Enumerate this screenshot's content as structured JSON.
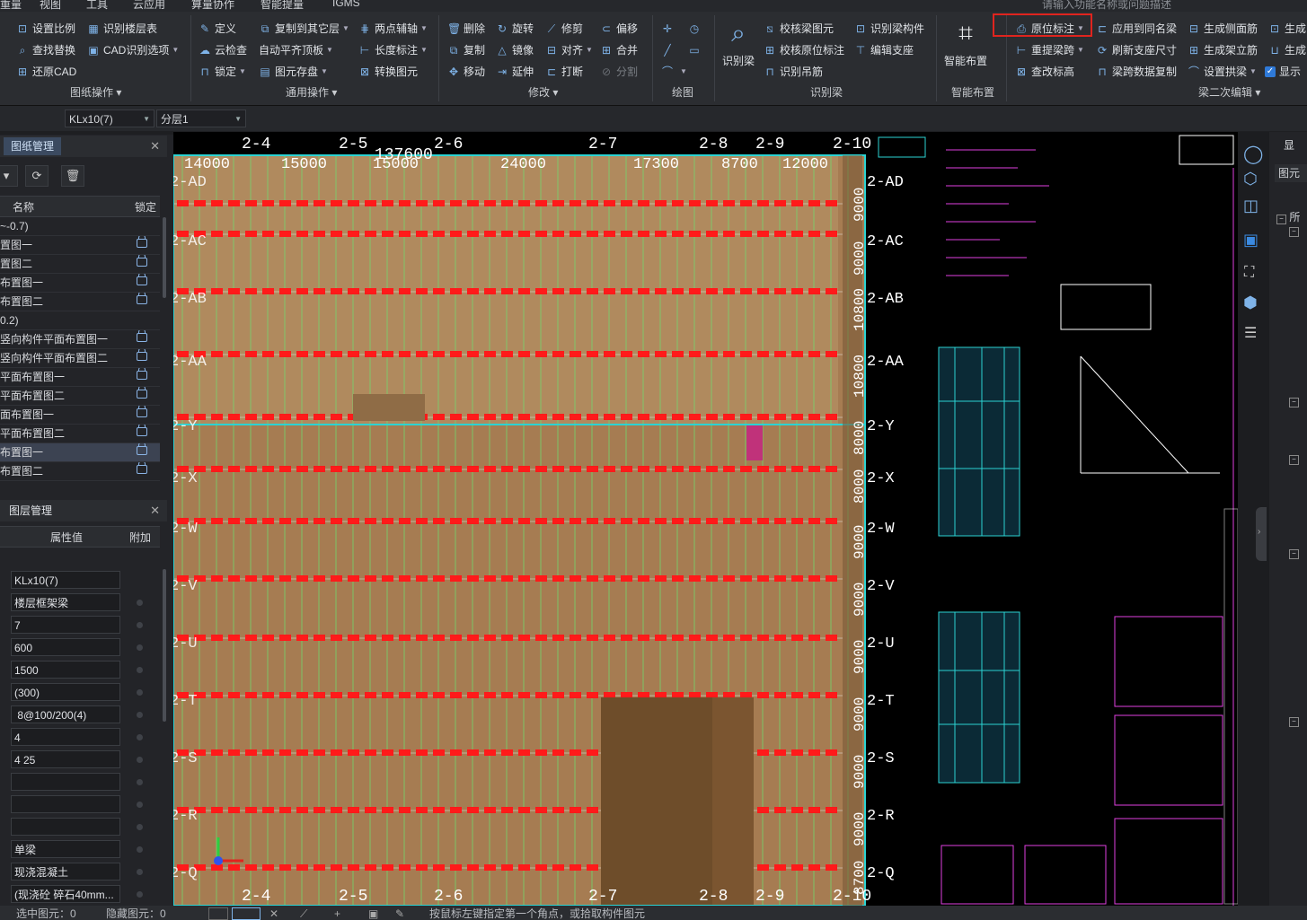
{
  "menu": [
    "重量",
    "视图",
    "工具",
    "云应用",
    "算量协作",
    "智能提量",
    "IGMS"
  ],
  "search_placeholder": "请输入功能名称或问题描述",
  "ribbon": {
    "drawing_ops": {
      "group_label": "图纸操作",
      "items": [
        "设置比例",
        "识别楼层表",
        "查找替换",
        "CAD识别选项",
        "还原CAD"
      ]
    },
    "general_ops": {
      "group_label": "通用操作",
      "items": [
        "定义",
        "复制到其它层",
        "两点辅轴",
        "云检查",
        "自动平齐顶板",
        "长度标注",
        "锁定",
        "图元存盘",
        "转换图元"
      ]
    },
    "modify": {
      "group_label": "修改",
      "items": [
        "删除",
        "旋转",
        "修剪",
        "偏移",
        "复制",
        "镜像",
        "对齐",
        "合并",
        "移动",
        "延伸",
        "打断",
        "分割"
      ]
    },
    "draw": {
      "group_label": "绘图"
    },
    "recognize_beam": {
      "group_label": "识别梁",
      "big_button": "识别梁",
      "items": [
        "校核梁图元",
        "识别梁构件",
        "校核原位标注",
        "编辑支座",
        "识别吊筋"
      ]
    },
    "smart_layout": {
      "group_label": "智能布置",
      "big_button": "智能布置"
    },
    "beam_edit": {
      "group_label": "梁二次编辑",
      "items": [
        "原位标注",
        "应用到同名梁",
        "生成侧面筋",
        "生成",
        "重提梁跨",
        "刷新支座尺寸",
        "生成架立筋",
        "生成",
        "查改标高",
        "梁跨数据复制",
        "设置拱梁",
        "显示"
      ]
    }
  },
  "toolbar": {
    "component_select": "KLx10(7)",
    "layer_select": "分层1"
  },
  "drawing_panel": {
    "tab": "图纸管理",
    "columns": {
      "name": "名称",
      "lock": "锁定"
    },
    "rows": [
      {
        "name": "~-0.7)",
        "locked": false
      },
      {
        "name": "置图一",
        "locked": true
      },
      {
        "name": "置图二",
        "locked": true
      },
      {
        "name": "布置图一",
        "locked": true
      },
      {
        "name": "布置图二",
        "locked": true
      },
      {
        "name": "0.2)",
        "locked": false
      },
      {
        "name": "竖向构件平面布置图一",
        "locked": true
      },
      {
        "name": "竖向构件平面布置图二",
        "locked": true
      },
      {
        "name": "平面布置图一",
        "locked": true
      },
      {
        "name": "平面布置图二",
        "locked": true
      },
      {
        "name": "面布置图一",
        "locked": true
      },
      {
        "name": "平面布置图二",
        "locked": true
      },
      {
        "name": "布置图一",
        "locked": true,
        "selected": true
      },
      {
        "name": "布置图二",
        "locked": true
      }
    ]
  },
  "layer_panel": {
    "title": "图层管理",
    "columns": {
      "value": "属性值",
      "extra": "附加"
    },
    "values": [
      "KLx10(7)",
      "楼层框架梁",
      "7",
      "600",
      "1500",
      "(300)",
      " 8@100/200(4)",
      "4",
      "4 25",
      "",
      "",
      "",
      "单梁",
      "现浇混凝土",
      "(现浇砼 碎石40mm..."
    ]
  },
  "canvas": {
    "top_axes": [
      "2-4",
      "2-5",
      "2-6",
      "2-7",
      "2-8",
      "2-9",
      "2-10"
    ],
    "bottom_axes": [
      "2-4",
      "2-5",
      "2-6",
      "2-7",
      "2-8",
      "2-9",
      "2-10"
    ],
    "top_dims": [
      "14000",
      "15000",
      "15000",
      "24000",
      "17300",
      "8700",
      "12000"
    ],
    "overall_dim": "137600",
    "right_axes": [
      "2-AD",
      "2-AC",
      "2-AB",
      "2-AA",
      "2-Y",
      "2-X",
      "2-W",
      "2-V",
      "2-U",
      "2-T",
      "2-S",
      "2-R",
      "2-Q"
    ],
    "left_axes": [
      "2-AD",
      "2-AC",
      "2-AB",
      "2-AA",
      "2-Y",
      "2-X",
      "2-W",
      "2-V",
      "2-U",
      "2-T",
      "2-S",
      "2-R",
      "2-Q"
    ],
    "right_dims": [
      "9000",
      "9000",
      "10800",
      "10800",
      "8000",
      "8000",
      "9000",
      "9000",
      "9000",
      "9000",
      "9000",
      "9000",
      "8700"
    ]
  },
  "right_panel": {
    "title": "显",
    "sub": "图元",
    "tree": "所"
  },
  "statusbar": {
    "selected": "选中图元：0",
    "hidden": "隐藏图元：0",
    "hint": "按鼠标左键指定第一个角点，或拾取构件图元"
  }
}
